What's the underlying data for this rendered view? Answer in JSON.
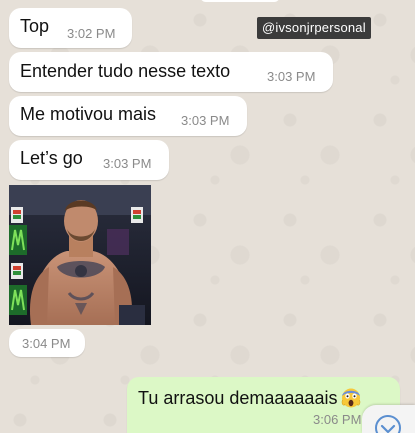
{
  "story_username": "@ivsonjrpersonal",
  "messages": [
    {
      "direction": "incoming",
      "text": "Top",
      "time": "3:02 PM"
    },
    {
      "direction": "incoming",
      "text": "Entender tudo nesse texto",
      "time": "3:03 PM"
    },
    {
      "direction": "incoming",
      "text": "Me motivou mais",
      "time": "3:03 PM"
    },
    {
      "direction": "incoming",
      "text": "Let’s go",
      "time": "3:03 PM"
    },
    {
      "direction": "incoming",
      "type": "sticker",
      "time": "3:04 PM"
    },
    {
      "direction": "outgoing",
      "text": "Tu arrasou demaaaaaais",
      "emoji": "screaming-face-emoji",
      "time": "3:06 PM"
    }
  ],
  "scroll_button_icon": "chevron-down-icon",
  "colors": {
    "incoming_bubble": "#ffffff",
    "outgoing_bubble": "#dcf8c6",
    "wallpaper": "#e6e0d8",
    "time_text": "#8a8a8a",
    "scroll_icon": "#5b8fd0"
  }
}
